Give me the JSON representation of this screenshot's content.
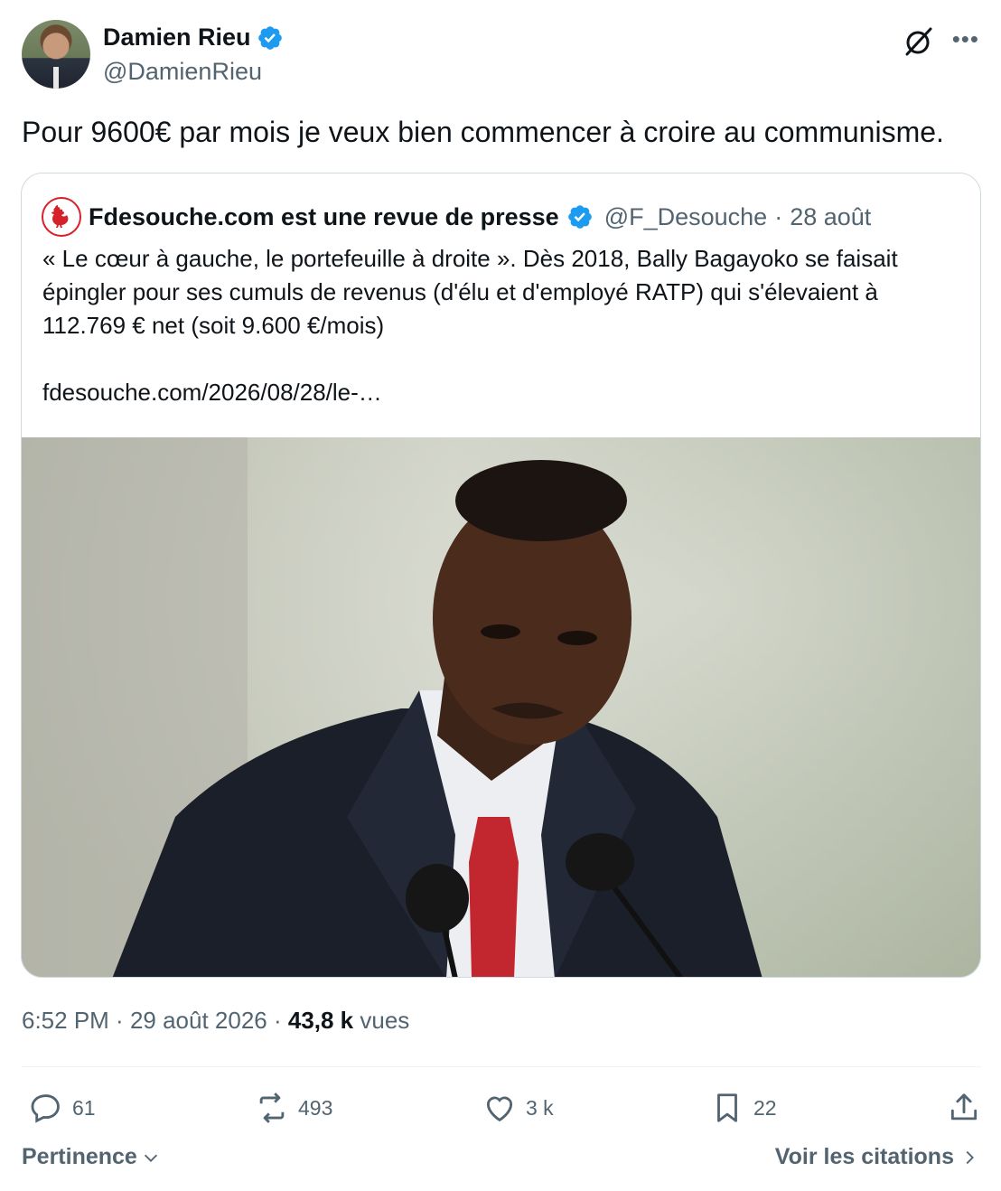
{
  "author": {
    "display_name": "Damien Rieu",
    "handle": "@DamienRieu",
    "verified": true
  },
  "icons": {
    "grok": "grok-icon",
    "more": "more-icon",
    "verified": "verified-badge-icon"
  },
  "tweet": {
    "text": "Pour 9600€ par mois je veux bien commencer à croire au communisme."
  },
  "quoted": {
    "display_name": "Fdesouche.com est une revue de presse",
    "handle": "@F_Desouche",
    "separator": "·",
    "date": "28 août",
    "verified": true,
    "text": "« Le cœur à gauche, le portefeuille à droite ». Dès 2018, Bally Bagayoko se faisait épingler pour ses cumuls de revenus (d'élu et d'employé RATP) qui s'élevaient à 112.769 € net (soit 9.600 €/mois)",
    "link": "fdesouche.com/2026/08/28/le-…"
  },
  "meta": {
    "time": "6:52 PM",
    "sep1": " · ",
    "date": "29 août 2026",
    "sep2": " · ",
    "views_count": "43,8 k",
    "views_label": " vues"
  },
  "actions": {
    "replies": "61",
    "reposts": "493",
    "likes": "3 k",
    "bookmarks": "22"
  },
  "footer": {
    "sort_label": "Pertinence",
    "quotes_label": "Voir les citations"
  },
  "colors": {
    "text": "#0f1419",
    "secondary": "#536471",
    "verified": "#1d9bf0",
    "border": "#cfd9de"
  }
}
